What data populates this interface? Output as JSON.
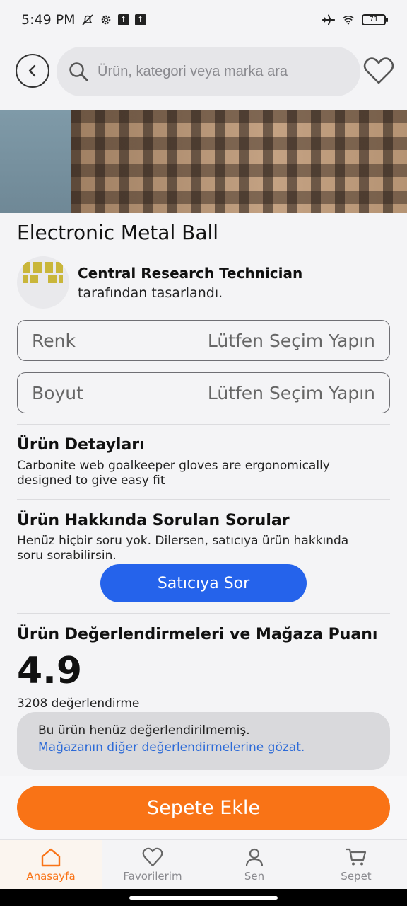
{
  "status": {
    "time": "5:49 PM",
    "battery": "71"
  },
  "search": {
    "placeholder": "Ürün, kategori veya marka ara"
  },
  "product": {
    "title": "Electronic Metal Ball",
    "designer_name": "Central Research Technician",
    "designer_suffix": "tarafından tasarlandı."
  },
  "options": [
    {
      "label": "Renk",
      "value": "Lütfen Seçim Yapın"
    },
    {
      "label": "Boyut",
      "value": "Lütfen Seçim Yapın"
    }
  ],
  "details": {
    "title": "Ürün Detayları",
    "text": "Carbonite web goalkeeper gloves are ergonomically designed to give easy fit"
  },
  "questions": {
    "title": "Ürün Hakkında Sorulan Sorular",
    "text": "Henüz hiçbir soru yok. Dilersen, satıcıya ürün hakkında soru sorabilirsin.",
    "ask_label": "Satıcıya Sor"
  },
  "reviews": {
    "title": "Ürün Değerlendirmeleri ve Mağaza Puanı",
    "score": "4.9",
    "count": "3208 değerlendirme",
    "notice": "Bu ürün henüz değerlendirilmemiş.",
    "link": "Mağazanın diğer değerlendirmelerine gözat."
  },
  "cart": {
    "label": "Sepete Ekle"
  },
  "nav": [
    {
      "label": "Anasayfa",
      "icon": "home-icon",
      "active": true
    },
    {
      "label": "Favorilerim",
      "icon": "heart-icon",
      "active": false
    },
    {
      "label": "Sen",
      "icon": "person-icon",
      "active": false
    },
    {
      "label": "Sepet",
      "icon": "cart-icon",
      "active": false
    }
  ],
  "colors": {
    "accent_orange": "#f97316",
    "accent_blue": "#2563eb",
    "link_blue": "#2c6ad7"
  }
}
